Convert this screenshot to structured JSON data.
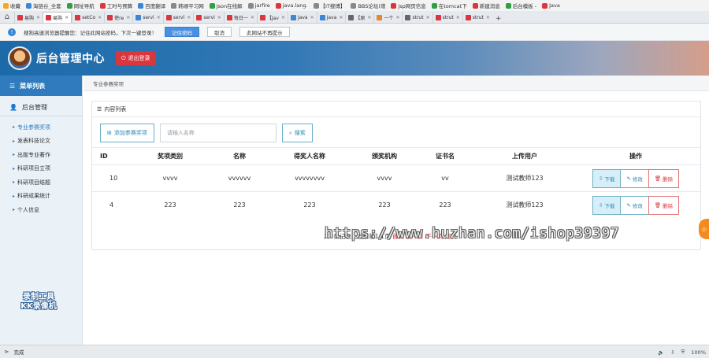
{
  "bookmarks": [
    "收藏",
    "淘链谷_全套",
    "网址导航",
    "工时与预算",
    "百度翻译",
    "韩顺平习网",
    "Json在线解",
    "jarfire",
    "java.lang.",
    "【IT搜博】",
    "BBS论坛(增",
    "jsp网页信息",
    "在tomcat下",
    "新建消息",
    "后台模板 -",
    "Java"
  ],
  "tabs": [
    {
      "label": "易购",
      "color": "r"
    },
    {
      "label": "易购",
      "color": "r",
      "active": true
    },
    {
      "label": "setCo",
      "color": "r"
    },
    {
      "label": "使re",
      "color": "r"
    },
    {
      "label": "servi",
      "color": "b"
    },
    {
      "label": "servl",
      "color": "r"
    },
    {
      "label": "servi",
      "color": "r"
    },
    {
      "label": "每日一",
      "color": "r"
    },
    {
      "label": "【Jav",
      "color": "r"
    },
    {
      "label": "Java",
      "color": "b"
    },
    {
      "label": "Java",
      "color": "b"
    },
    {
      "label": "【原",
      "color": "k"
    },
    {
      "label": "一个",
      "color": "o"
    },
    {
      "label": "strut",
      "color": "k"
    },
    {
      "label": "strut",
      "color": "r"
    },
    {
      "label": "strut",
      "color": "r"
    }
  ],
  "notify": {
    "text": "搜狗高速浏览器提醒您：记住此网站密码，下次一键登录！",
    "remember": "记住密码",
    "cancel": "取消",
    "never": "此网站不再提示"
  },
  "header": {
    "title": "后台管理中心",
    "logout": "退出登录"
  },
  "sidebar": {
    "menu_title": "菜单列表",
    "group": "后台管理",
    "items": [
      "专业参赛奖项",
      "发表科技论文",
      "出版专业著作",
      "科研项目立项",
      "科研项目结题",
      "科研成果统计",
      "个人信息"
    ],
    "watermark_line1": "录制工具",
    "watermark_line2": "KK录像机"
  },
  "breadcrumb": "专业参赛奖项",
  "panel": {
    "title": "内容列表",
    "add_label": "添加参赛奖项",
    "search_placeholder": "请输入名称",
    "search_label": "搜索"
  },
  "table": {
    "columns": [
      "ID",
      "奖项类别",
      "名称",
      "得奖人名称",
      "颁奖机构",
      "证书名",
      "上传用户",
      "操作"
    ],
    "rows": [
      {
        "id": "10",
        "category": "vvvv",
        "name": "vvvvvv",
        "winner": "vvvvvvvv",
        "org": "vvvv",
        "cert": "vv",
        "user": "测试教师123"
      },
      {
        "id": "4",
        "category": "223",
        "name": "223",
        "winner": "223",
        "org": "223",
        "cert": "223",
        "user": "测试教师123"
      }
    ],
    "op_download": "下载",
    "op_edit": "修改",
    "op_delete": "删除"
  },
  "footer_note_a": "共2条记录，当前第1/1页",
  "footer_note_b": "首页 上一页 下一页 尾页",
  "site_watermark": "https://www.huzhan.com/ishop39397",
  "float_badge": "小",
  "status": {
    "left": "完成",
    "zoom": "100%"
  }
}
